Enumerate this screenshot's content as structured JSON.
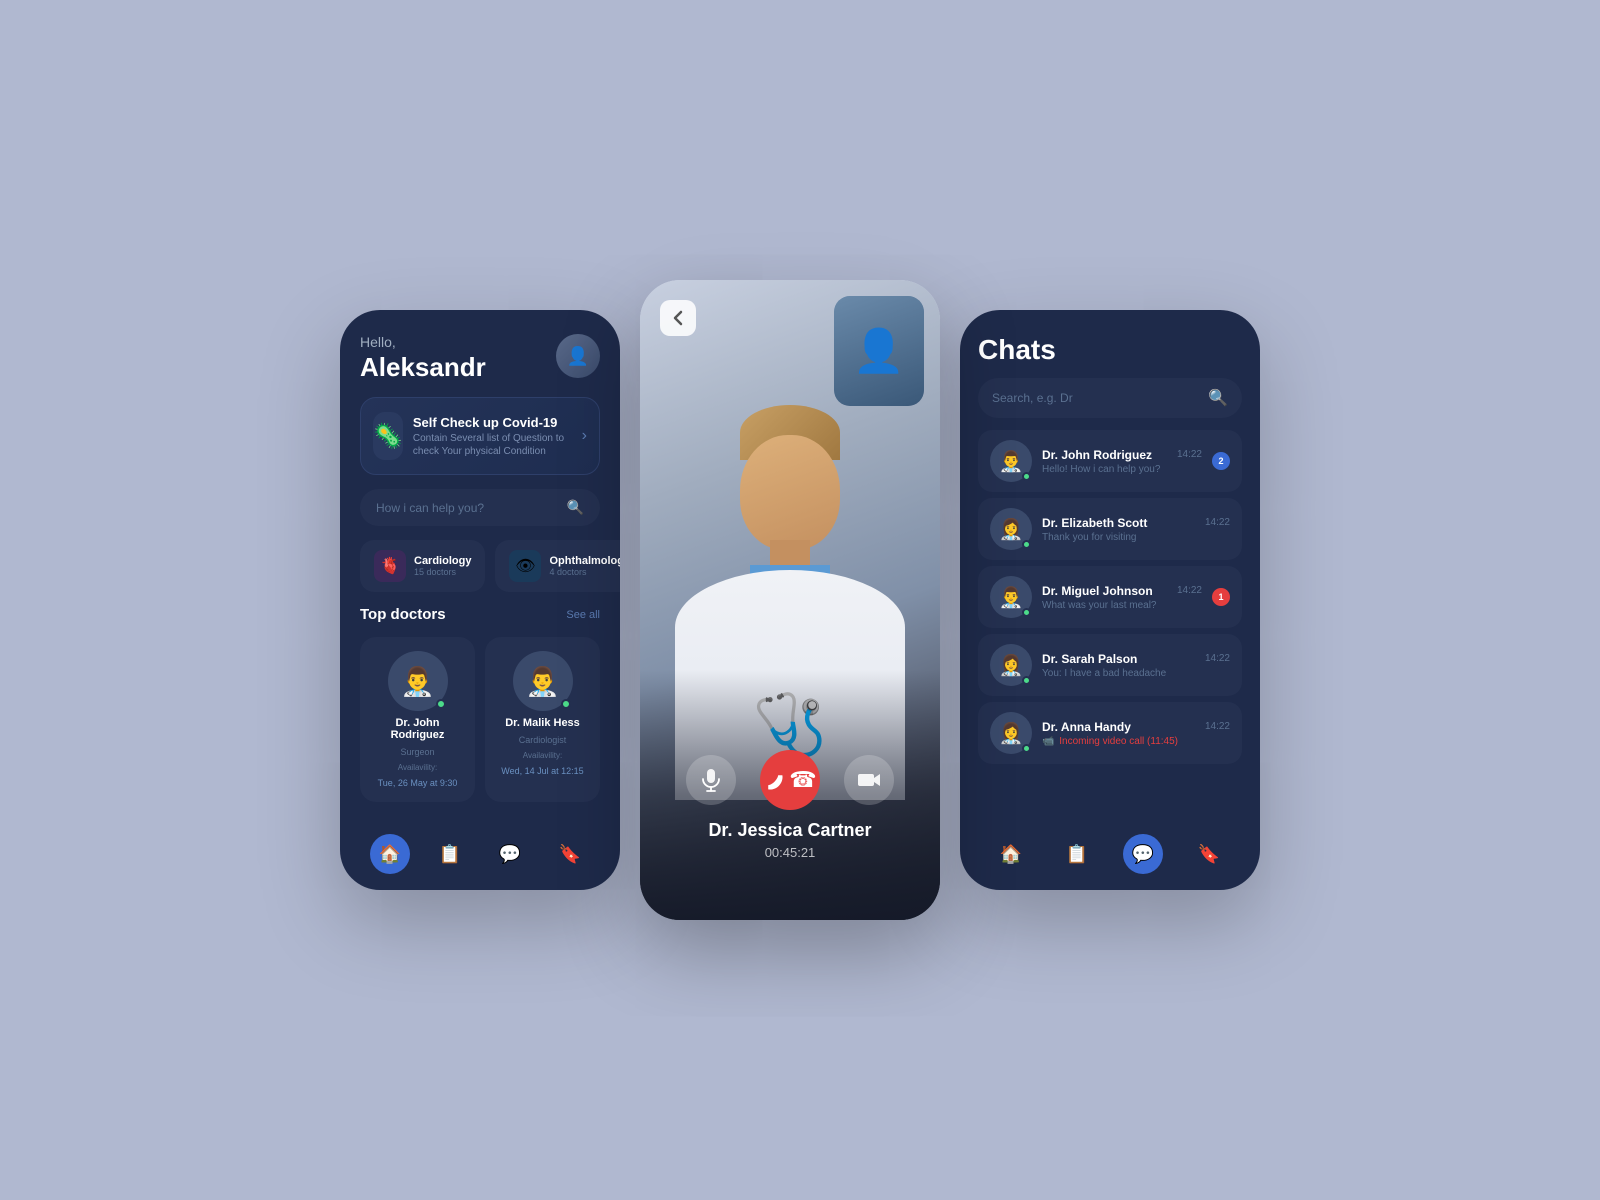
{
  "app": {
    "bg_color": "#b0b8d0"
  },
  "phone1": {
    "greeting": "Hello,",
    "user_name": "Aleksandr",
    "covid_card": {
      "title": "Self Check up Covid-19",
      "description": "Contain Several list of Question to check Your physical Condition"
    },
    "search": {
      "placeholder": "How i can help you?"
    },
    "categories": [
      {
        "name": "Cardiology",
        "count": "15 doctors",
        "icon": "🫀"
      },
      {
        "name": "Ophthalmology",
        "count": "4 doctors",
        "icon": "👁"
      }
    ],
    "top_doctors_title": "Top doctors",
    "see_all_label": "See all",
    "doctors": [
      {
        "name": "Dr. John Rodriguez",
        "specialty": "Surgeon",
        "avail_label": "Availavility:",
        "avail_time": "Tue, 26 May at 9:30",
        "icon": "👨‍⚕️"
      },
      {
        "name": "Dr. Malik Hess",
        "specialty": "Cardiologist",
        "avail_label": "Availavility:",
        "avail_time": "Wed, 14 Jul at 12:15",
        "icon": "👨‍⚕️"
      }
    ],
    "nav": {
      "home": "🏠",
      "book": "📋",
      "chat": "💬",
      "bookmark": "🔖"
    }
  },
  "phone2": {
    "back_icon": "‹",
    "doctor_name": "Dr. Jessica Cartner",
    "timer": "00:45:21",
    "controls": {
      "mic": "🎤",
      "end": "📵",
      "camera": "🎥"
    }
  },
  "phone3": {
    "title": "Chats",
    "search_placeholder": "Search, e.g. Dr",
    "chats": [
      {
        "name": "Dr. John Rodriguez",
        "time": "14:22",
        "message": "Hello! How i can help you?",
        "badge": "2",
        "badge_color": "blue",
        "icon": "👨‍⚕️"
      },
      {
        "name": "Dr. Elizabeth Scott",
        "time": "14:22",
        "message": "Thank you for visiting",
        "badge": "",
        "badge_color": "",
        "icon": "👩‍⚕️"
      },
      {
        "name": "Dr. Miguel Johnson",
        "time": "14:22",
        "message": "What was your last meal?",
        "badge": "1",
        "badge_color": "red",
        "icon": "👨‍⚕️"
      },
      {
        "name": "Dr. Sarah Palson",
        "time": "14:22",
        "message": "You: I have a bad headache",
        "badge": "",
        "badge_color": "",
        "icon": "👩‍⚕️"
      },
      {
        "name": "Dr. Anna Handy",
        "time": "14:22",
        "message": "Incoming video call (11:45)",
        "badge": "",
        "badge_color": "",
        "icon": "👩‍⚕️",
        "is_video_call": true
      }
    ],
    "nav_active": "chat"
  }
}
